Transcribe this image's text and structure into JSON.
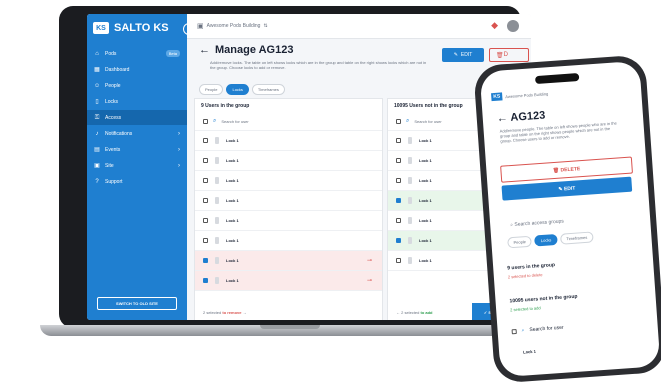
{
  "brand": {
    "name": "SALTO KS",
    "mark": "KS"
  },
  "sidebar": {
    "items": [
      {
        "label": "Pods",
        "icon": "home-icon",
        "badge": "Beta"
      },
      {
        "label": "Dashboard",
        "icon": "grid-icon"
      },
      {
        "label": "People",
        "icon": "people-icon"
      },
      {
        "label": "Locks",
        "icon": "lock-icon"
      },
      {
        "label": "Access",
        "icon": "key-icon",
        "active": true
      },
      {
        "label": "Notifications",
        "icon": "bell-icon",
        "chevron": true
      },
      {
        "label": "Events",
        "icon": "calendar-icon",
        "chevron": true
      },
      {
        "label": "Site",
        "icon": "building-icon",
        "chevron": true
      },
      {
        "label": "Support",
        "icon": "help-icon"
      }
    ],
    "switch_label": "SWITCH TO OLD SITE"
  },
  "topbar": {
    "breadcrumb": "Awesome Pods Building",
    "sort_icon": "sort-icon"
  },
  "page": {
    "title": "Manage AG123",
    "description": "Add/remove locks. The table on left shows locks which are in the group and table on the right shows locks which are not in the group. Choose locks to add or remove.",
    "edit_label": "EDIT",
    "delete_label": "D"
  },
  "tabs": [
    {
      "label": "People"
    },
    {
      "label": "Locks",
      "active": true
    },
    {
      "label": "Timeframes"
    }
  ],
  "left_panel": {
    "header": "9 Users in the group",
    "search_placeholder": "Search for user",
    "rows": [
      {
        "name": "Lock 1",
        "checked": false
      },
      {
        "name": "Lock 1",
        "checked": false
      },
      {
        "name": "Lock 1",
        "checked": false
      },
      {
        "name": "Lock 1",
        "checked": false
      },
      {
        "name": "Lock 1",
        "checked": false
      },
      {
        "name": "Lock 1",
        "checked": false
      },
      {
        "name": "Lock 1",
        "checked": true
      },
      {
        "name": "Lock 1",
        "checked": true
      }
    ],
    "footer_count": "2 selected",
    "footer_action": "to remove"
  },
  "right_panel": {
    "header": "10095 Users not in the group",
    "search_placeholder": "Search for user",
    "rows": [
      {
        "name": "Lock 1",
        "checked": false
      },
      {
        "name": "Lock 1",
        "checked": false
      },
      {
        "name": "Lock 1",
        "checked": false
      },
      {
        "name": "Lock 1",
        "checked": true
      },
      {
        "name": "Lock 1",
        "checked": false
      },
      {
        "name": "Lock 1",
        "checked": true
      },
      {
        "name": "Lock 1",
        "checked": false
      }
    ],
    "footer_count": "2 selected",
    "footer_action": "to add",
    "save_label": "SAVE CHANGES"
  },
  "phone": {
    "mark": "KS",
    "breadcrumb": "Awesome Pods Building",
    "title": "AG123",
    "description": "Add/remove people. The table on left shows people who are in the group and table on the right shows people which are not in the group. Choose users to add or remove.",
    "delete_label": "DELETE",
    "edit_label": "EDIT",
    "search_placeholder": "Search access groups",
    "tabs": [
      {
        "label": "People"
      },
      {
        "label": "Locks",
        "active": true
      },
      {
        "label": "Timeframes"
      }
    ],
    "in_group_title": "9 users in the group",
    "in_group_sub": "2 selected to delete",
    "not_in_group_title": "10095 users not in the group",
    "not_in_group_sub": "2 selected to add",
    "search_user": "Search for user",
    "lock_label": "Lock 1"
  },
  "colors": {
    "primary": "#1f7fd0",
    "danger": "#d9534f",
    "success": "#2e9e4f"
  }
}
